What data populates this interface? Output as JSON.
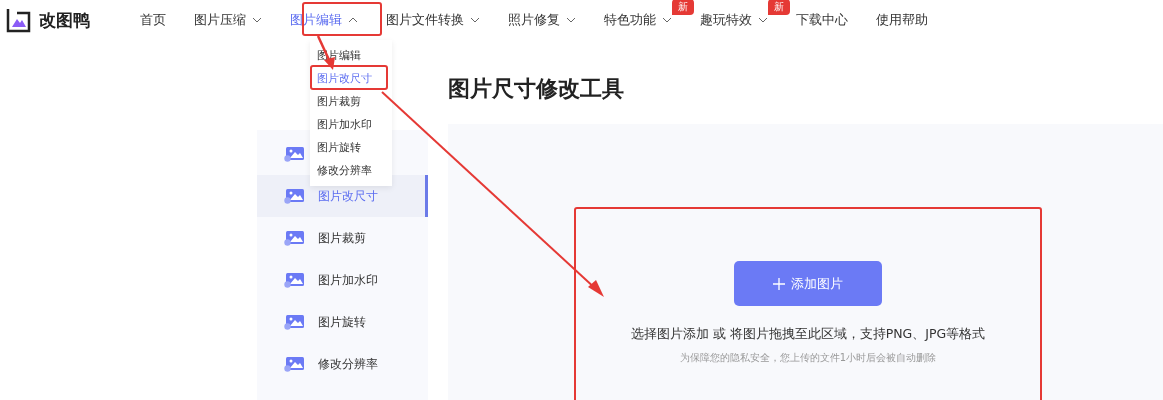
{
  "logo": {
    "text": "改图鸭"
  },
  "nav": [
    {
      "label": "首页",
      "dropdown": false,
      "selected": false
    },
    {
      "label": "图片压缩",
      "dropdown": true,
      "selected": false
    },
    {
      "label": "图片编辑",
      "dropdown": true,
      "selected": true,
      "expanded": true
    },
    {
      "label": "图片文件转换",
      "dropdown": true,
      "selected": false
    },
    {
      "label": "照片修复",
      "dropdown": true,
      "selected": false
    },
    {
      "label": "特色功能",
      "dropdown": true,
      "selected": false,
      "badge": "新"
    },
    {
      "label": "趣玩特效",
      "dropdown": true,
      "selected": false,
      "badge": "新"
    },
    {
      "label": "下载中心",
      "dropdown": false,
      "selected": false
    },
    {
      "label": "使用帮助",
      "dropdown": false,
      "selected": false
    }
  ],
  "dropdown_menu": [
    {
      "label": "图片编辑",
      "selected": false
    },
    {
      "label": "图片改尺寸",
      "selected": true
    },
    {
      "label": "图片裁剪",
      "selected": false
    },
    {
      "label": "图片加水印",
      "selected": false
    },
    {
      "label": "图片旋转",
      "selected": false
    },
    {
      "label": "修改分辨率",
      "selected": false
    }
  ],
  "sidebar": {
    "items": [
      {
        "selected": false
      },
      {
        "label": "图片改尺寸",
        "selected": true
      },
      {
        "label": "图片裁剪",
        "selected": false
      },
      {
        "label": "图片加水印",
        "selected": false
      },
      {
        "label": "图片旋转",
        "selected": false
      },
      {
        "label": "修改分辨率",
        "selected": false
      }
    ]
  },
  "page_title": "图片尺寸修改工具",
  "upload": {
    "button": "添加图片",
    "hint": "选择图片添加 或 将图片拖拽至此区域，支持PNG、JPG等格式",
    "note": "为保障您的隐私安全，您上传的文件1小时后会被自动删除"
  }
}
